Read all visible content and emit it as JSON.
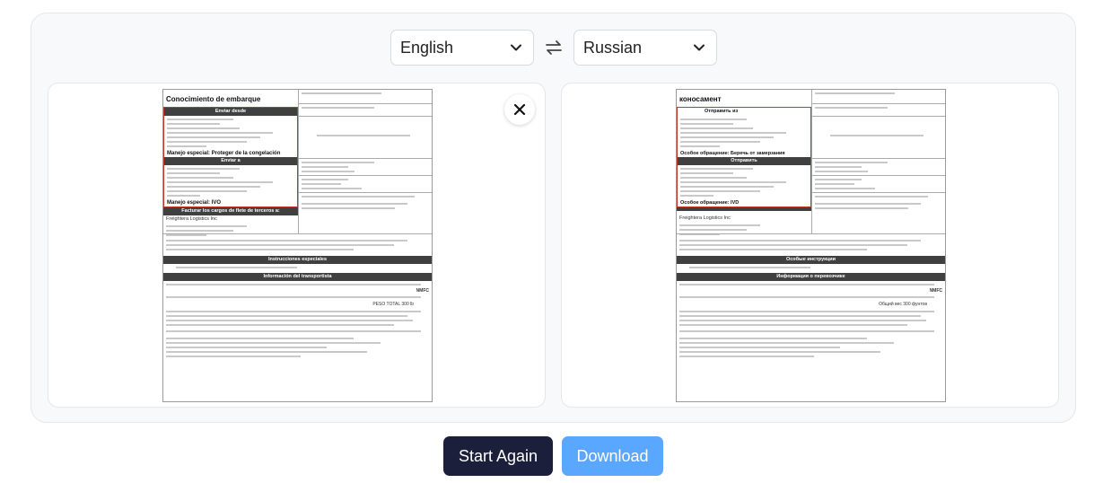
{
  "languages": {
    "source": "English",
    "target": "Russian",
    "source_icon": "chevron-down-icon",
    "target_icon": "chevron-down-icon",
    "swap_icon": "swap-arrows-icon"
  },
  "source_doc": {
    "title": "Conocimiento de embarque",
    "ship_from_header": "Enviar desde",
    "ship_to_header": "Enviar a",
    "special_handling_1": "Manejo especial: Proteger de la congelación",
    "special_handling_2": "Manejo especial: IVO",
    "freight_charges_header": "Facturar los cargos de flete de terceros a:",
    "carrier_name": "Freightera Logistics Inc",
    "special_instructions_header": "Instrucciones especiales",
    "commodity_header": "Información del transportista",
    "nmfc_label": "NMFC",
    "total_weight": "PESO TOTAL 300 lb"
  },
  "target_doc": {
    "title": "коносамент",
    "ship_from_header": "Отправить из",
    "ship_to_header": "Отправить",
    "special_handling_1": "Особое обращение: Беречь от замерзания",
    "special_handling_2": "Особое обращение: IVD",
    "carrier_name": "Freightera Logistics Inc",
    "special_instructions_header": "Особые инструкции",
    "commodity_header": "Информация о перевозчике",
    "nmfc_label": "NMFC",
    "total_weight": "Общий вес 300 фунтов"
  },
  "close_icon": "close-icon",
  "buttons": {
    "start_again": "Start Again",
    "download": "Download"
  },
  "colors": {
    "primary_dark": "#1b1f3b",
    "accent_blue": "#5aa7ff",
    "doc_highlight": "#c0392b"
  }
}
